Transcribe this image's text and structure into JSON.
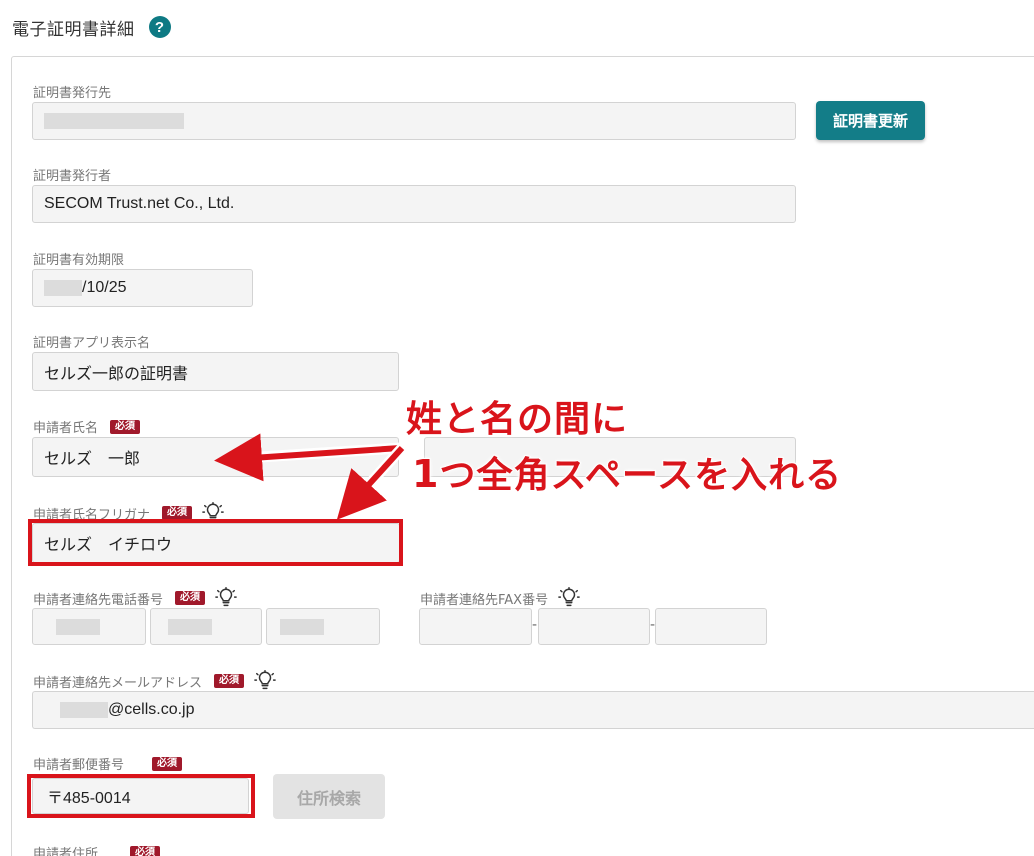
{
  "header": {
    "title": "電子証明書詳細",
    "help_icon": "question-circle-icon",
    "help_glyph": "?"
  },
  "issuer_to": {
    "label": "証明書発行先",
    "button_label": "証明書更新"
  },
  "issuer": {
    "label": "証明書発行者",
    "value": "SECOM Trust.net Co., Ltd."
  },
  "expiry": {
    "label": "証明書有効期限",
    "value_visible": "/10/25"
  },
  "app_name": {
    "label": "証明書アプリ表示名",
    "value": "セルズ一郎の証明書"
  },
  "applicant_name": {
    "label": "申請者氏名",
    "required": "必須",
    "value": "セルズ　一郎"
  },
  "applicant_kana": {
    "label": "申請者氏名フリガナ",
    "required": "必須",
    "value": "セルズ　イチロウ",
    "hint_icon": "lightbulb-icon"
  },
  "phone": {
    "label": "申請者連絡先電話番号",
    "required": "必須",
    "hint_icon": "lightbulb-icon"
  },
  "fax": {
    "label": "申請者連絡先FAX番号",
    "hint_icon": "lightbulb-icon",
    "separator": "-"
  },
  "email": {
    "label": "申請者連絡先メールアドレス",
    "required": "必須",
    "value_visible": "@cells.co.jp",
    "hint_icon": "lightbulb-icon"
  },
  "postal": {
    "label": "申請者郵便番号",
    "required": "必須",
    "value": "〒485-0014",
    "button_label": "住所検索"
  },
  "address": {
    "label": "申請者住所",
    "required": "必須"
  },
  "annotation": {
    "line1": "姓と名の間に",
    "line2_num": "1",
    "line2_rest": "つ全角スペースを入れる",
    "color": "#d9141b"
  },
  "colors": {
    "accent": "#137d88",
    "required_badge": "#a0192b",
    "annotation": "#d9141b"
  }
}
